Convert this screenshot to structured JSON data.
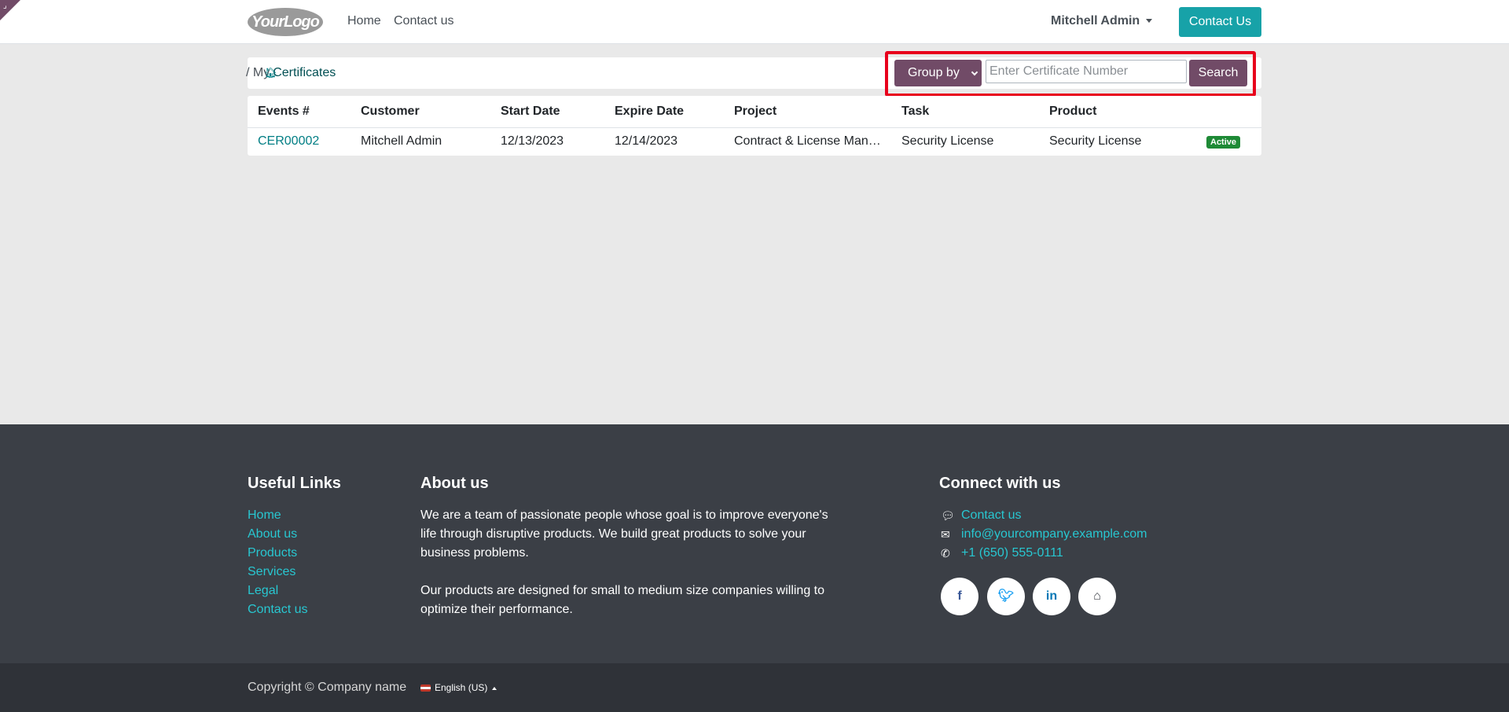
{
  "header": {
    "logo_text": "YourLogo",
    "nav": {
      "home": "Home",
      "contact": "Contact us"
    },
    "user": "Mitchell Admin",
    "contact_button": "Contact Us"
  },
  "breadcrumb": {
    "prefix": "/ My",
    "label": "Certificates"
  },
  "toolbar": {
    "groupby_label": "Group by",
    "search_placeholder": "Enter Certificate Number",
    "search_button": "Search"
  },
  "table": {
    "columns": [
      "Events #",
      "Customer",
      "Start Date",
      "Expire Date",
      "Project",
      "Task",
      "Product",
      ""
    ],
    "rows": [
      {
        "number": "CER00002",
        "customer": "Mitchell Admin",
        "start": "12/13/2023",
        "expire": "12/14/2023",
        "project": "Contract & License Management",
        "task": "Security License",
        "product": "Security License",
        "status": "Active"
      }
    ]
  },
  "footer": {
    "useful_links": {
      "title": "Useful Links",
      "items": [
        "Home",
        "About us",
        "Products",
        "Services",
        "Legal",
        "Contact us"
      ]
    },
    "about": {
      "title": "About us",
      "p1": "We are a team of passionate people whose goal is to improve everyone's life through disruptive products. We build great products to solve your business problems.",
      "p2": "Our products are designed for small to medium size companies willing to optimize their performance."
    },
    "connect": {
      "title": "Connect with us",
      "contact": "Contact us",
      "email": "info@yourcompany.example.com",
      "phone": "+1 (650) 555-0111"
    },
    "copyright": "Copyright © Company name",
    "language": "English (US)"
  },
  "colors": {
    "primary": "#714b67",
    "accent": "#17a2a8",
    "link": "#017e84",
    "footer_bg": "#3b3f46",
    "highlight": "#e8001c",
    "badge": "#1e8a36"
  }
}
